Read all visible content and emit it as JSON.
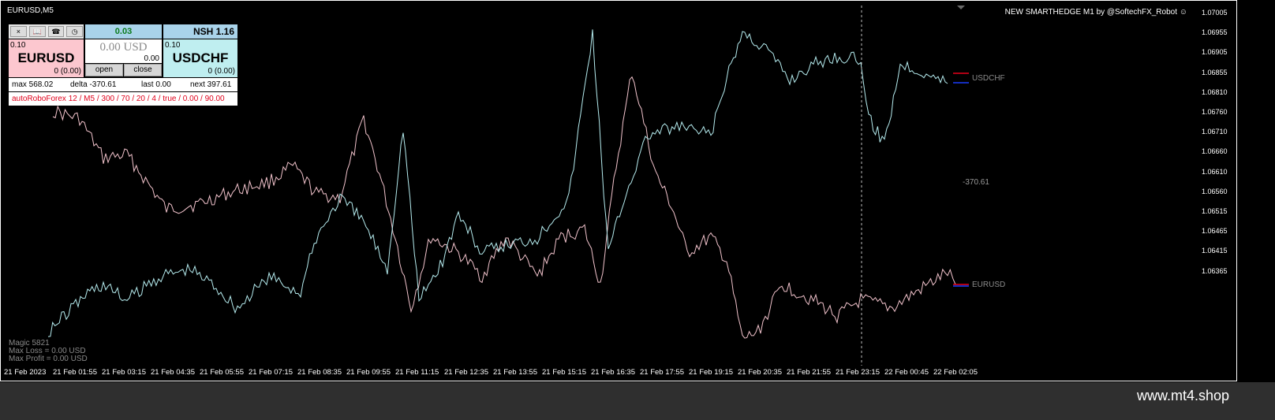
{
  "chart": {
    "title": "EURUSD,M5",
    "brand": "NEW SMARTHEDGE M1 by @SoftechFX_Robot",
    "brand_icon": "smiley-icon",
    "price_labels": [
      "1.07005",
      "1.06955",
      "1.06905",
      "1.06855",
      "1.06810",
      "1.06760",
      "1.06710",
      "1.06660",
      "1.06610",
      "1.06560",
      "1.06515",
      "1.06465",
      "1.06415",
      "1.06365"
    ],
    "time_labels": [
      "21 Feb 2023",
      "21 Feb 01:55",
      "21 Feb 03:15",
      "21 Feb 04:35",
      "21 Feb 05:55",
      "21 Feb 07:15",
      "21 Feb 08:35",
      "21 Feb 09:55",
      "21 Feb 11:15",
      "21 Feb 12:35",
      "21 Feb 13:55",
      "21 Feb 15:15",
      "21 Feb 16:35",
      "21 Feb 17:55",
      "21 Feb 19:15",
      "21 Feb 20:35",
      "21 Feb 21:55",
      "21 Feb 23:15",
      "22 Feb 00:45",
      "22 Feb 02:05"
    ],
    "series_tags": {
      "usdchf": "USDCHF",
      "eurusd": "EURUSD"
    },
    "delta_value": "-370.61",
    "colors": {
      "eurusd": "#f2c3cc",
      "usdchf": "#b5ecef",
      "background": "#000000",
      "axis_text": "#ffffff"
    }
  },
  "panel": {
    "tools": [
      {
        "glyph": "×",
        "name": "close-panel-icon"
      },
      {
        "glyph": "📖",
        "name": "book-icon"
      },
      {
        "glyph": "☎",
        "name": "phone-icon"
      },
      {
        "glyph": "◷",
        "name": "clock-icon"
      }
    ],
    "profit": "0.03",
    "nsh": "NSH 1.16",
    "left": {
      "lot": "0.10",
      "symbol": "EURUSD",
      "sub": "0 (0.00)"
    },
    "right": {
      "lot": "0.10",
      "symbol": "USDCHF",
      "sub": "0 (0.00)"
    },
    "mid": {
      "usd": "0.00 USD",
      "sub": "0.00"
    },
    "open_label": "open",
    "close_label": "close",
    "stats": {
      "max": "max 568.02",
      "delta": "delta -370.61",
      "last": "last 0.00",
      "next": "next 397.61"
    },
    "expert": "autoRoboForex 12 / M5 / 300 / 70 / 20 / 4 / true / 0.00 / 90.00"
  },
  "magic": {
    "line1": "Magic 5821",
    "line2": "Max Loss = 0.00 USD",
    "line3": "Max Profit = 0.00 USD"
  },
  "footer": {
    "url": "www.mt4.shop"
  }
}
